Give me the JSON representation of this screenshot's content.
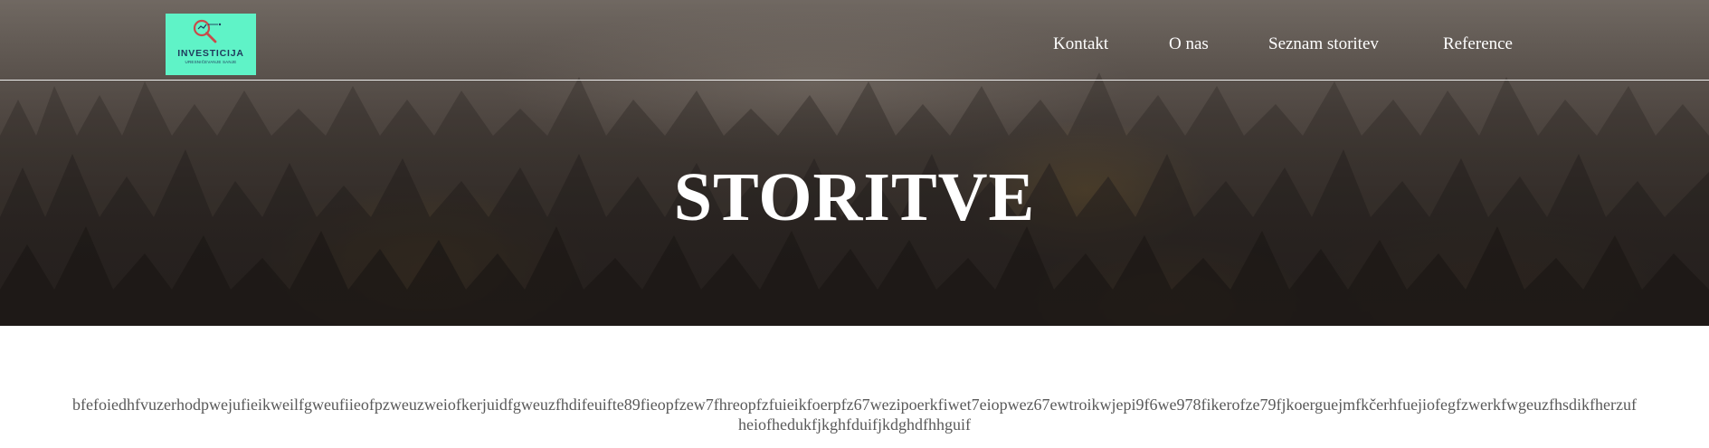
{
  "logo": {
    "title": "INVESTICIJA",
    "subtitle": "URESNIČEVANJE SANJE",
    "colors": {
      "background": "#5ff3c7",
      "text": "#1f3a5c",
      "magnifier": "#c94a4a"
    },
    "icon": "magnifier-icon"
  },
  "nav": {
    "items": [
      {
        "label": "Kontakt"
      },
      {
        "label": "O nas"
      },
      {
        "label": "Seznam storitev"
      },
      {
        "label": "Reference"
      }
    ]
  },
  "hero": {
    "title": "STORITVE"
  },
  "content": {
    "text": "bfefoiedhfvuzerhodpwejufieikweilfgweufiieofpzweuzweiofkerjuidfgweuzfhdifeuifte89fieopfzew7fhreopfzfuieikfoerpfz67wezipoerkfiwet7eiopwez67ewtroikwjepi9f6we978fikerofze79fjkoerguejmfkčerhfuejiofegfzwerkfwgeuzfhsdikfherzufheiofhedukfjkghfduifjkdghdfhhguif"
  },
  "colors": {
    "nav_text": "#ffffff",
    "body_text": "#595959"
  }
}
